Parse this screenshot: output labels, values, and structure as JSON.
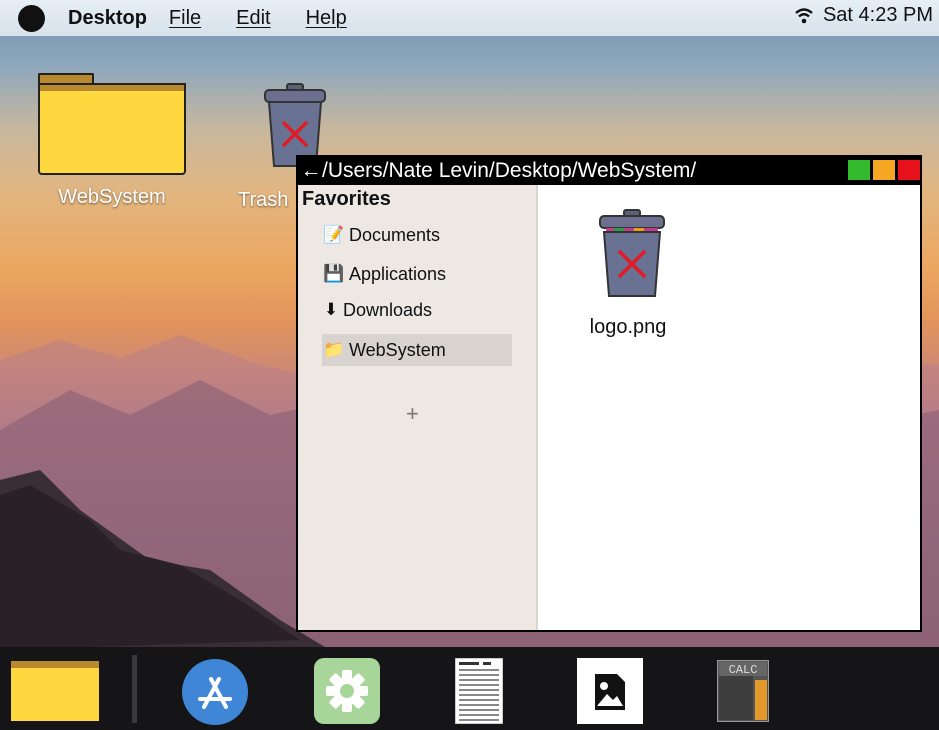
{
  "menubar": {
    "app_name": "Desktop",
    "menus": [
      "File",
      "Edit",
      "Help"
    ],
    "clock": "Sat 4:23 PM"
  },
  "desktop": {
    "icons": [
      {
        "label": "WebSystem",
        "icon": "folder-icon"
      },
      {
        "label": "Trash",
        "icon": "trash-icon"
      }
    ]
  },
  "window": {
    "path": "/Users/Nate Levin/Desktop/WebSystem/",
    "controls": {
      "green": "#33b92c",
      "orange": "#f5a623",
      "red": "#e8101b"
    },
    "sidebar": {
      "title": "Favorites",
      "items": [
        {
          "label": "Documents",
          "icon": "document-pencil-icon"
        },
        {
          "label": "Applications",
          "icon": "floppy-disk-icon"
        },
        {
          "label": "Downloads",
          "icon": "download-arrow-icon"
        },
        {
          "label": "WebSystem",
          "icon": "folder-icon",
          "selected": true
        }
      ],
      "add_label": "+"
    },
    "files": [
      {
        "name": "logo.png",
        "icon": "trash-icon"
      }
    ]
  },
  "dock": {
    "items": [
      "folder-icon",
      "app-store-icon",
      "settings-gear-icon",
      "text-document-icon",
      "image-viewer-icon",
      "calculator-icon"
    ],
    "calc_label": "CALC"
  }
}
